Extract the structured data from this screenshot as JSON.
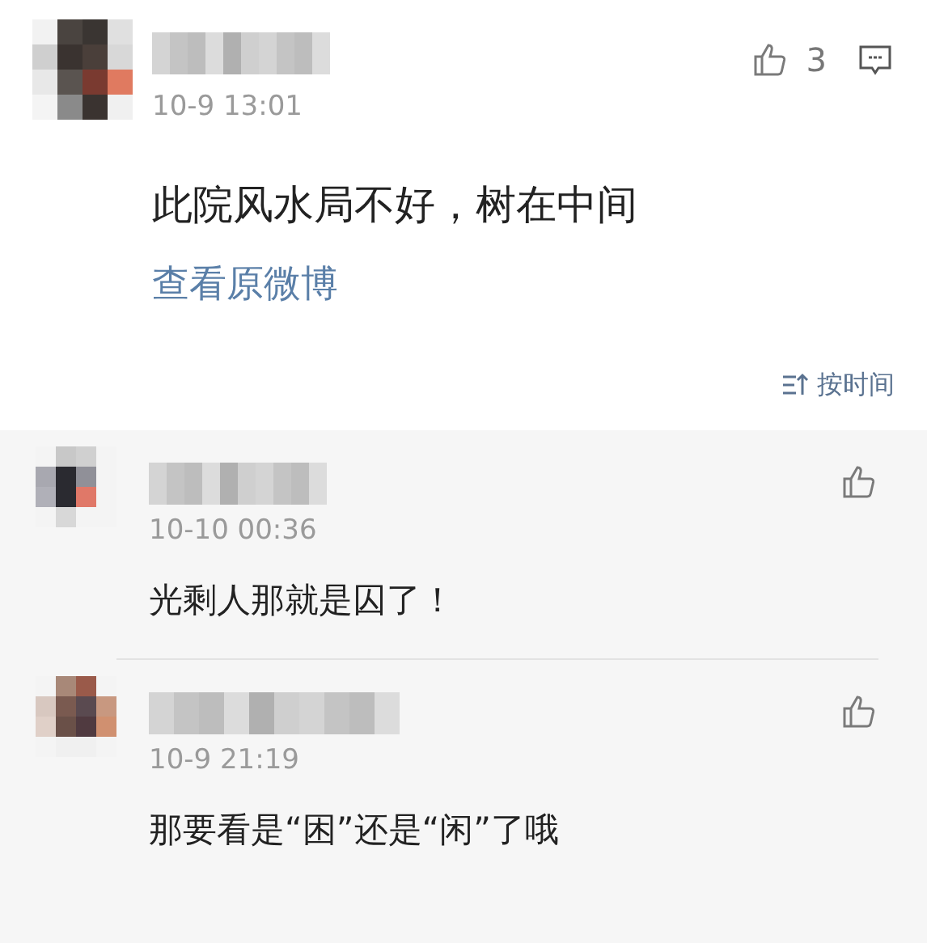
{
  "post": {
    "like_count": "3",
    "time": "10-9 13:01",
    "text": "此院风水局不好，树在中间",
    "link": "查看原微博",
    "sort": "按时间"
  },
  "replies": [
    {
      "time": "10-10 00:36",
      "text": "光剩人那就是囚了！"
    },
    {
      "time": "10-9 21:19",
      "text": "那要看是“困”还是“闲”了哦"
    }
  ]
}
